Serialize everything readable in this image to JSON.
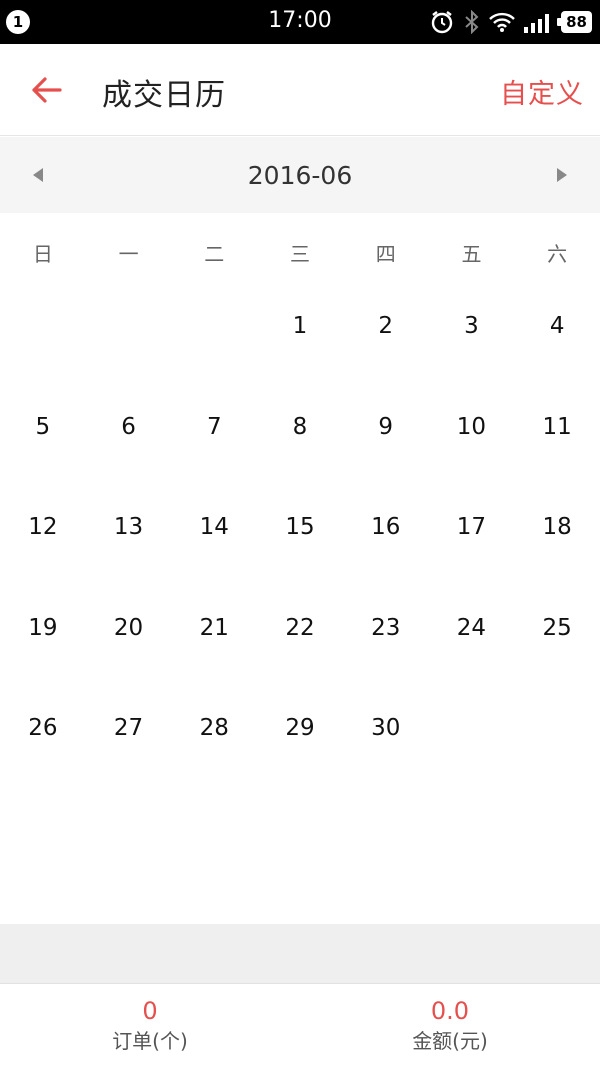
{
  "status_bar": {
    "notification_count": "1",
    "time": "17:00",
    "battery": "88"
  },
  "header": {
    "title": "成交日历",
    "action_label": "自定义"
  },
  "month_nav": {
    "month": "2016-06"
  },
  "weekdays": [
    "日",
    "一",
    "二",
    "三",
    "四",
    "五",
    "六"
  ],
  "calendar": {
    "days": [
      "",
      "",
      "",
      "1",
      "2",
      "3",
      "4",
      "5",
      "6",
      "7",
      "8",
      "9",
      "10",
      "11",
      "12",
      "13",
      "14",
      "15",
      "16",
      "17",
      "18",
      "19",
      "20",
      "21",
      "22",
      "23",
      "24",
      "25",
      "26",
      "27",
      "28",
      "29",
      "30",
      "",
      ""
    ]
  },
  "summary": {
    "orders_value": "0",
    "orders_label": "订单(个)",
    "amount_value": "0.0",
    "amount_label": "金额(元)"
  },
  "colors": {
    "accent": "#e5504e"
  }
}
